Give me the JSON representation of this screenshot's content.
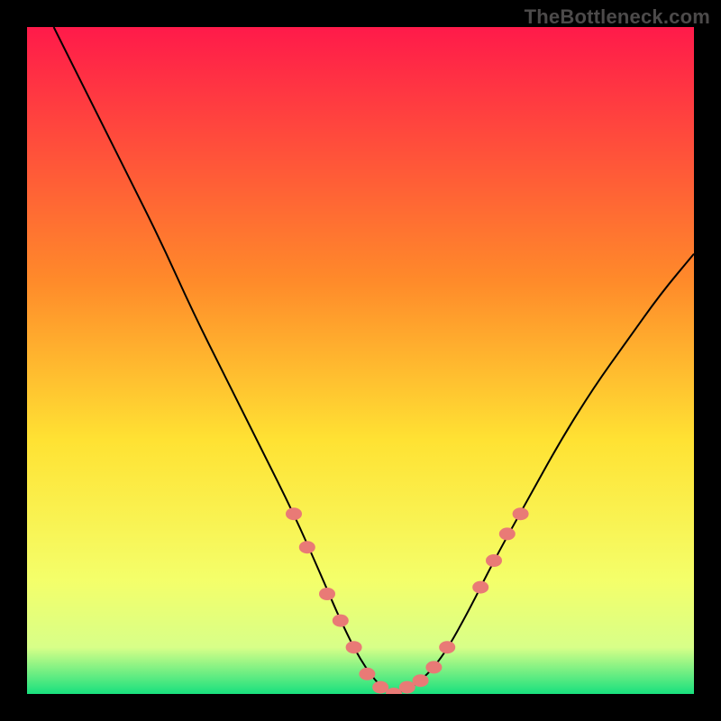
{
  "watermark": "TheBottleneck.com",
  "gradient": {
    "top": "#ff1a4a",
    "mid1": "#ff8a2a",
    "mid2": "#ffe233",
    "low": "#f4ff6a",
    "veryLow": "#d8ff88",
    "bottom": "#18e07e"
  },
  "curve_color": "#000000",
  "marker_color": "#e97a76",
  "chart_data": {
    "type": "line",
    "title": "",
    "xlabel": "",
    "ylabel": "",
    "xlim": [
      0,
      100
    ],
    "ylim": [
      0,
      100
    ],
    "series": [
      {
        "name": "bottleneck-curve",
        "x": [
          4,
          10,
          15,
          20,
          25,
          30,
          35,
          40,
          44,
          47,
          50,
          53,
          55,
          58,
          62,
          66,
          70,
          75,
          80,
          85,
          90,
          95,
          100
        ],
        "values": [
          100,
          88,
          78,
          68,
          57,
          47,
          37,
          27,
          18,
          11,
          5,
          1,
          0,
          1,
          5,
          12,
          20,
          29,
          38,
          46,
          53,
          60,
          66
        ]
      }
    ],
    "markers": {
      "name": "highlighted-points",
      "x": [
        40,
        42,
        45,
        47,
        49,
        51,
        53,
        55,
        57,
        59,
        61,
        63,
        68,
        70,
        72,
        74
      ],
      "values": [
        27,
        22,
        15,
        11,
        7,
        3,
        1,
        0,
        1,
        2,
        4,
        7,
        16,
        20,
        24,
        27
      ]
    }
  }
}
